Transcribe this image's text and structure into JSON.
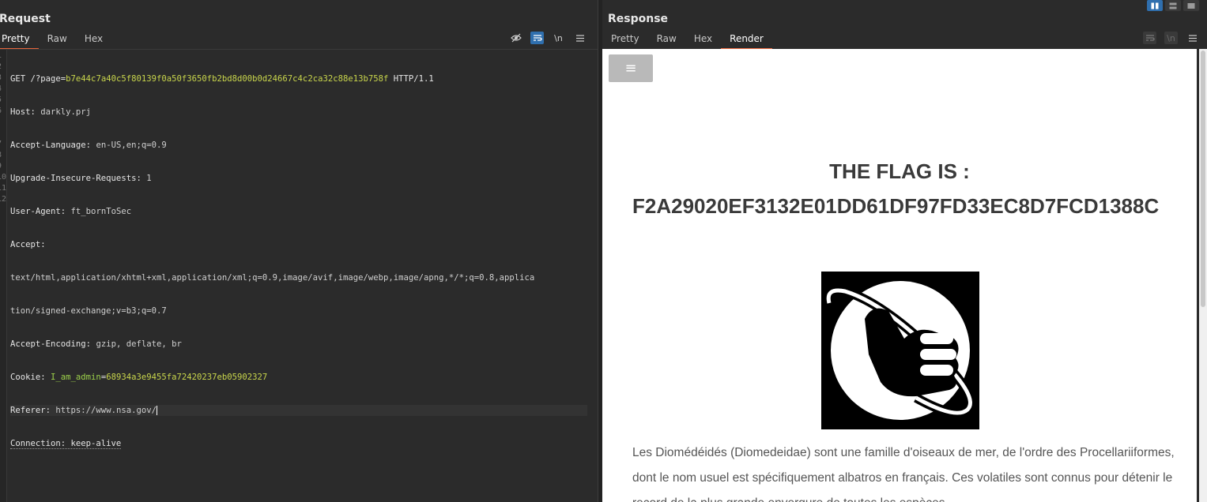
{
  "request": {
    "title": "Request",
    "tabs": [
      "Pretty",
      "Raw",
      "Hex"
    ],
    "active_tab": "Pretty",
    "tools": {
      "newline": "\\n"
    },
    "line_numbers": [
      "1",
      "2",
      "3",
      "4",
      "5",
      "6",
      "",
      "7",
      "8",
      "9",
      "10",
      "11",
      "12"
    ],
    "lines": {
      "l1_method": "GET /?page=",
      "l1_hash": "b7e44c7a40c5f80139f0a50f3650fb2bd8d00b0d24667c4c2ca32c88e13b758f",
      "l1_proto": " HTTP/1.1",
      "l2_key": "Host:",
      "l2_val": " darkly.prj",
      "l3_key": "Accept-Language:",
      "l3_val": " en-US,en;q=0.9",
      "l4_key": "Upgrade-Insecure-Requests:",
      "l4_val": " 1",
      "l5_key": "User-Agent:",
      "l5_val": " ft_bornToSec",
      "l6_key": "Accept:",
      "l6_wrap1": "text/html,application/xhtml+xml,application/xml;q=0.9,image/avif,image/webp,image/apng,*/*;q=0.8,applica",
      "l6_wrap2": "tion/signed-exchange;v=b3;q=0.7",
      "l7_key": "Accept-Encoding:",
      "l7_val": " gzip, deflate, br",
      "l8_key": "Cookie:",
      "l8_cookie_name": " I_am_admin",
      "l8_eq": "=",
      "l8_cookie_val": "68934a3e9455fa72420237eb05902327",
      "l9_key": "Referer:",
      "l9_val": " https://www.nsa.gov/",
      "l10_text": "Connection: keep-alive"
    }
  },
  "response": {
    "title": "Response",
    "tabs": [
      "Pretty",
      "Raw",
      "Hex",
      "Render"
    ],
    "active_tab": "Render",
    "render": {
      "menu_glyph": "≡",
      "flag_title": "THE FLAG IS :",
      "flag_value": "F2A29020EF3132E01DD61DF97FD33EC8D7FCD1388C",
      "paragraph": "Les Diomédéidés (Diomedeidae) sont une famille d'oiseaux de mer, de l'ordre des Procellariiformes, dont le nom usuel est spécifiquement albatros en français. Ces volatiles sont connus pour détenir le record de la plus grande envergure de toutes les espèces"
    }
  },
  "colors": {
    "accent_tab": "#e8663c",
    "toggle_on": "#2f6fae",
    "cookie_value": "#c9d64c"
  }
}
